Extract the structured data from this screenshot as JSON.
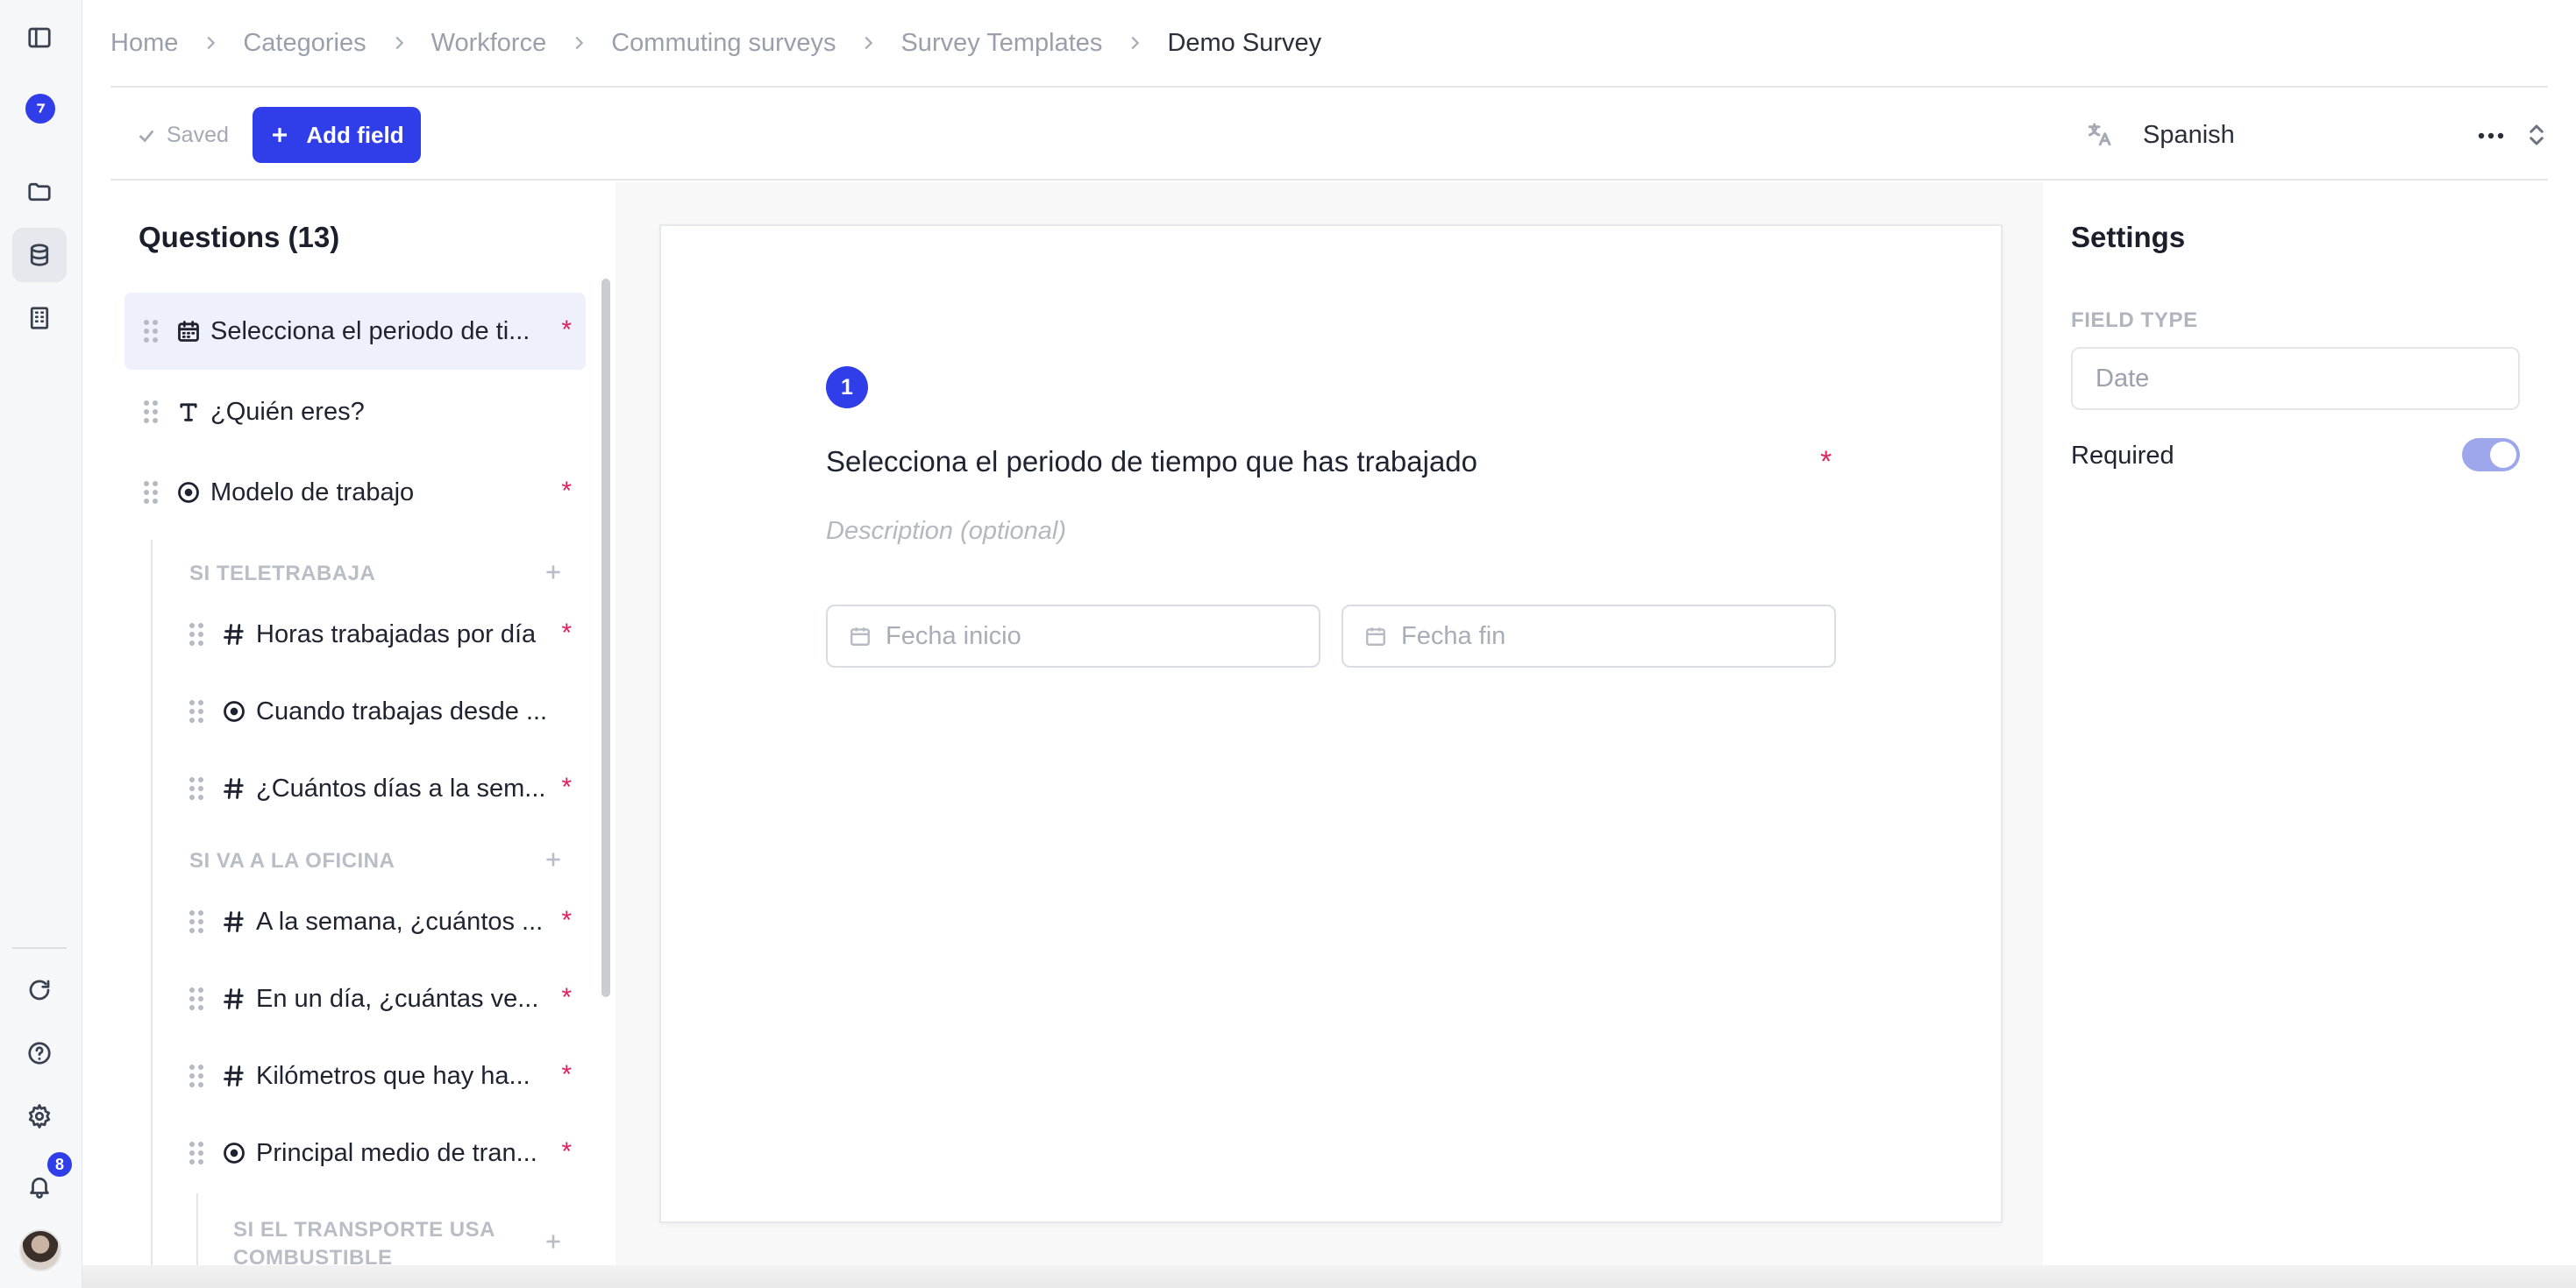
{
  "breadcrumb": [
    "Home",
    "Categories",
    "Workforce",
    "Commuting surveys",
    "Survey Templates",
    "Demo Survey"
  ],
  "toolbar": {
    "saved_label": "Saved",
    "add_field_label": "Add field",
    "language": "Spanish"
  },
  "rail": {
    "notification_count": "8"
  },
  "questions": {
    "title": "Questions (13)",
    "items": [
      {
        "label": "Selecciona el periodo de ti...",
        "icon": "calendar-icon",
        "required": true,
        "selected": true
      },
      {
        "label": "¿Quién eres?",
        "icon": "text-icon",
        "required": false
      },
      {
        "label": "Modelo de trabajo",
        "icon": "radio-icon",
        "required": true
      }
    ],
    "groups": [
      {
        "label": "SI TELETRABAJA",
        "items": [
          {
            "label": "Horas trabajadas por día",
            "icon": "hash-icon",
            "required": true
          },
          {
            "label": "Cuando trabajas desde ...",
            "icon": "radio-icon",
            "required": false
          },
          {
            "label": "¿Cuántos días a la sem...",
            "icon": "hash-icon",
            "required": true
          }
        ]
      },
      {
        "label": "SI VA A LA OFICINA",
        "items": [
          {
            "label": "A la semana, ¿cuántos ...",
            "icon": "hash-icon",
            "required": true
          },
          {
            "label": "En un día, ¿cuántas ve...",
            "icon": "hash-icon",
            "required": true
          },
          {
            "label": "Kilómetros que hay ha...",
            "icon": "hash-icon",
            "required": true
          },
          {
            "label": "Principal medio de tran...",
            "icon": "radio-icon",
            "required": true
          }
        ]
      },
      {
        "label": "SI EL TRANSPORTE USA COMBUSTIBLE",
        "items": []
      }
    ],
    "required_mark": "*"
  },
  "card": {
    "number": "1",
    "title": "Selecciona el periodo de tiempo que has trabajado",
    "required_mark": "*",
    "description_placeholder": "Description (optional)",
    "start_placeholder": "Fecha inicio",
    "end_placeholder": "Fecha fin"
  },
  "settings": {
    "title": "Settings",
    "field_type_label": "FIELD TYPE",
    "field_type_value": "Date",
    "required_label": "Required",
    "required_on": true
  },
  "colors": {
    "accent": "#2f3ee8",
    "required": "#e0245e",
    "toggle_on": "#9ea6ec"
  }
}
